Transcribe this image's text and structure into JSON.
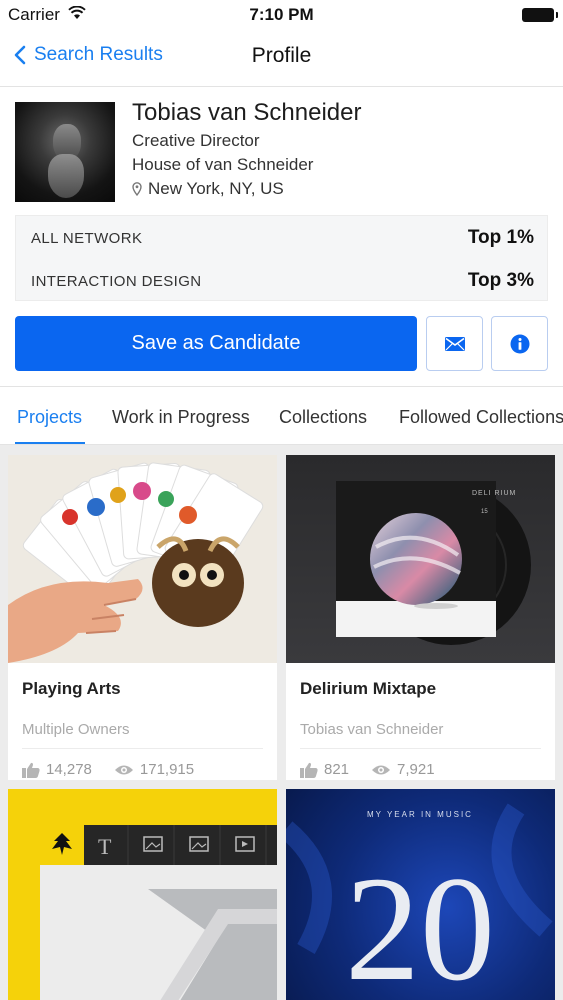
{
  "status": {
    "carrier": "Carrier",
    "time": "7:10 PM"
  },
  "nav": {
    "back_label": "Search Results",
    "title": "Profile"
  },
  "profile": {
    "name": "Tobias van Schneider",
    "role": "Creative Director",
    "company": "House of van Schneider",
    "location": "New York, NY, US",
    "ranks": [
      {
        "label": "ALL NETWORK",
        "value": "Top 1%"
      },
      {
        "label": "INTERACTION DESIGN",
        "value": "Top 3%"
      }
    ],
    "save_label": "Save as Candidate"
  },
  "tabs": [
    {
      "label": "Projects",
      "active": true
    },
    {
      "label": "Work in Progress"
    },
    {
      "label": "Collections"
    },
    {
      "label": "Followed Collections"
    }
  ],
  "projects": [
    {
      "title": "Playing Arts",
      "owner": "Multiple Owners",
      "likes": "14,278",
      "views": "171,915"
    },
    {
      "title": "Delirium Mixtape",
      "owner": "Tobias van Schneider",
      "likes": "821",
      "views": "7,921"
    }
  ],
  "thumb_text": {
    "delirium_cover": "DELI RIUM",
    "delirium_no": "15",
    "music_header": "MY YEAR IN MUSIC",
    "music_number": "20",
    "toolbar_t": "T"
  },
  "colors": {
    "accent": "#1a7ff0",
    "button": "#0a66f0",
    "yellow": "#f5d20a",
    "navy": "#0e2a78"
  }
}
